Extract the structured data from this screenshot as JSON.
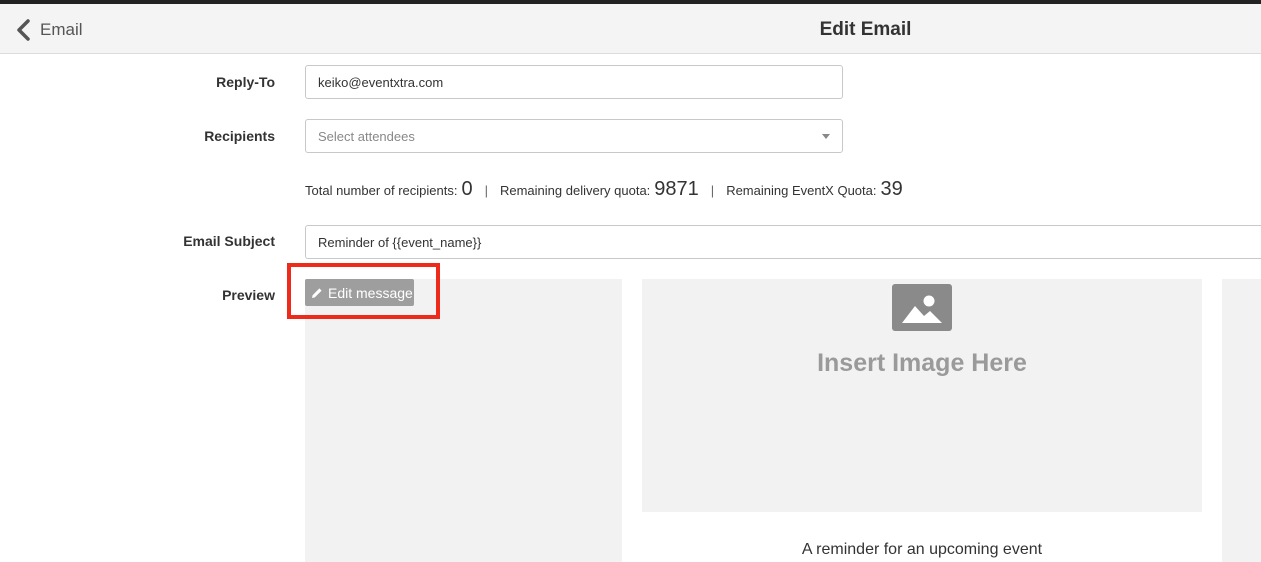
{
  "header": {
    "back_label": "Email",
    "title": "Edit Email"
  },
  "form": {
    "reply_to": {
      "label": "Reply-To",
      "value": "keiko@eventxtra.com"
    },
    "recipients": {
      "label": "Recipients",
      "placeholder": "Select attendees"
    },
    "stats": {
      "total_label": "Total number of recipients:",
      "total_value": "0",
      "separator": "|",
      "delivery_label": "Remaining delivery quota:",
      "delivery_value": "9871",
      "eventx_label": "Remaining EventX Quota:",
      "eventx_value": "39"
    },
    "subject": {
      "label": "Email Subject",
      "value": "Reminder of {{event_name}}"
    },
    "preview": {
      "label": "Preview",
      "edit_button": "Edit message"
    }
  },
  "preview_content": {
    "image_placeholder": "Insert Image Here",
    "body_text": "A reminder for an upcoming event"
  },
  "colors": {
    "highlight": "#ee2a1b",
    "button_bg": "#9e9e9e",
    "panel_bg": "#f2f2f2"
  },
  "icons": {
    "back": "chevron-left-icon",
    "edit": "pencil-icon",
    "image": "image-placeholder-icon",
    "dropdown": "caret-down-icon"
  }
}
